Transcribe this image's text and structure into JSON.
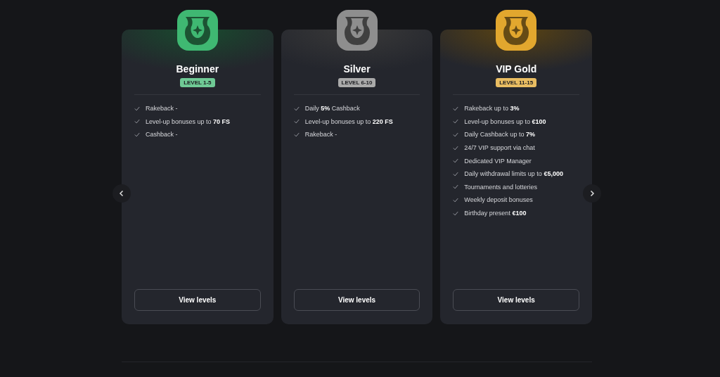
{
  "tiers": [
    {
      "name": "Beginner",
      "level_label": "LEVEL 1-5",
      "color": "#3fb872",
      "features": [
        "Rakeback -",
        "Level-up bonuses up to **70 FS**",
        "Cashback -"
      ],
      "button": "View levels"
    },
    {
      "name": "Silver",
      "level_label": "LEVEL 6-10",
      "color": "#8e8e8e",
      "features": [
        "Daily **5%** Cashback",
        "Level-up bonuses up to **220 FS**",
        "Rakeback -"
      ],
      "button": "View levels"
    },
    {
      "name": "VIP Gold",
      "level_label": "LEVEL 11-15",
      "color": "#e2a72e",
      "features": [
        "Rakeback up to **3%**",
        "Level-up bonuses up to **€100**",
        "Daily Cashback up to **7%**",
        "24/7 VIP support via chat",
        "Dedicated VIP Manager",
        "Daily withdrawal limits up to **€5,000**",
        "Tournaments and lotteries",
        "Weekly deposit bonuses",
        "Birthday present **€100**"
      ],
      "button": "View levels"
    }
  ]
}
